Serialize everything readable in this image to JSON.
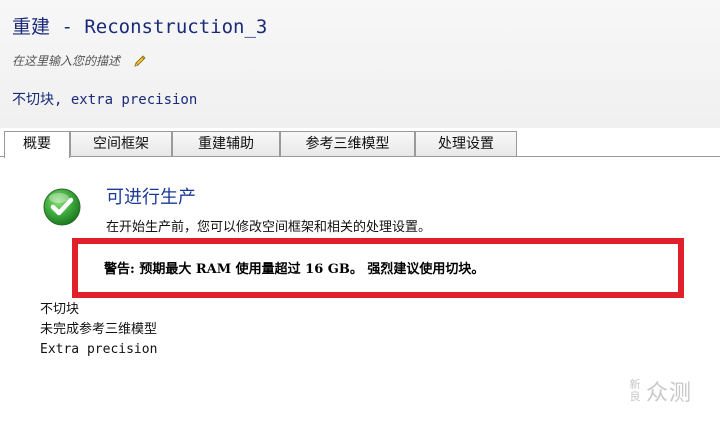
{
  "header": {
    "title": "重建 - Reconstruction_3",
    "description_placeholder": "在这里输入您的描述",
    "summary": "不切块, extra precision"
  },
  "tabs": [
    {
      "label": "概要"
    },
    {
      "label": "空间框架"
    },
    {
      "label": "重建辅助"
    },
    {
      "label": "参考三维模型"
    },
    {
      "label": "处理设置"
    }
  ],
  "status": {
    "title": "可进行生产",
    "description": "在开始生产前，您可以修改空间框架和相关的处理设置。",
    "icon": "check-circle-icon",
    "icon_color": "#3aa63a"
  },
  "warning": {
    "text": "警告: 预期最大 RAM 使用量超过 16 GB。 强烈建议使用切块。",
    "border_color": "#e0202a"
  },
  "details": {
    "line1": "不切块",
    "line2": "未完成参考三维模型",
    "line3": "Extra precision"
  },
  "watermark": {
    "top": "新",
    "bottom": "良",
    "text": "众测"
  },
  "colors": {
    "title": "#1a2a78",
    "status_title": "#1a3a9a"
  }
}
